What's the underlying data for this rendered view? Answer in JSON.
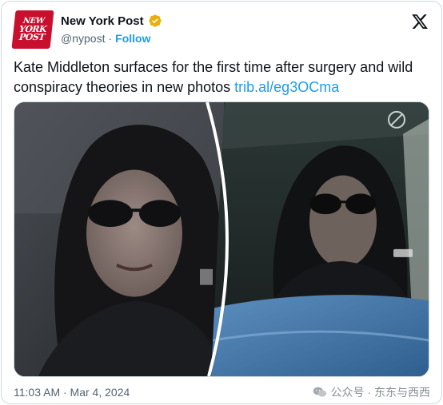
{
  "account": {
    "avatar_line1": "NEW",
    "avatar_line2": "YORK",
    "avatar_line3": "POST",
    "display_name": "New York Post",
    "handle": "@nypost",
    "separator": "·",
    "follow_label": "Follow",
    "verified_color": "#e8b00e"
  },
  "tweet": {
    "text": "Kate Middleton surfaces for the first time after surgery and wild conspiracy theories in new photos ",
    "link": "trib.al/eg3OCma",
    "timestamp": "11:03 AM · Mar 4, 2024"
  },
  "media": {
    "photo_count": 2
  },
  "watermark": {
    "text": "公众号 · 东东与西西"
  },
  "colors": {
    "accent": "#1d9bf0",
    "secondary_text": "#536471",
    "brand_red": "#c8102e"
  }
}
